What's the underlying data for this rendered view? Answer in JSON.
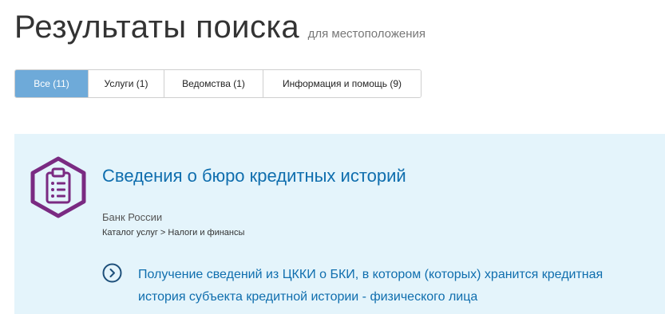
{
  "header": {
    "title": "Результаты поиска",
    "subtitle": "для местоположения"
  },
  "tabs": [
    {
      "label": "Все (11)",
      "active": true
    },
    {
      "label": "Услуги (1)",
      "active": false
    },
    {
      "label": "Ведомства (1)",
      "active": false
    },
    {
      "label": "Информация и помощь (9)",
      "active": false
    }
  ],
  "result": {
    "icon": "clipboard-checklist-icon",
    "title": "Сведения о бюро кредитных историй",
    "organization": "Банк России",
    "breadcrumb": "Каталог услуг > Налоги и финансы",
    "sub_icon": "chevron-right-circle-icon",
    "sub_link_line1": "Получение сведений из ЦККИ о БКИ, в котором (которых) хранится кредитная",
    "sub_link_line2": "история субъекта кредитной истории - физического лица"
  },
  "colors": {
    "accent": "#6eaad9",
    "link": "#0f6eae",
    "card_bg": "#e4f4fb",
    "icon_purple": "#7a2a82"
  }
}
